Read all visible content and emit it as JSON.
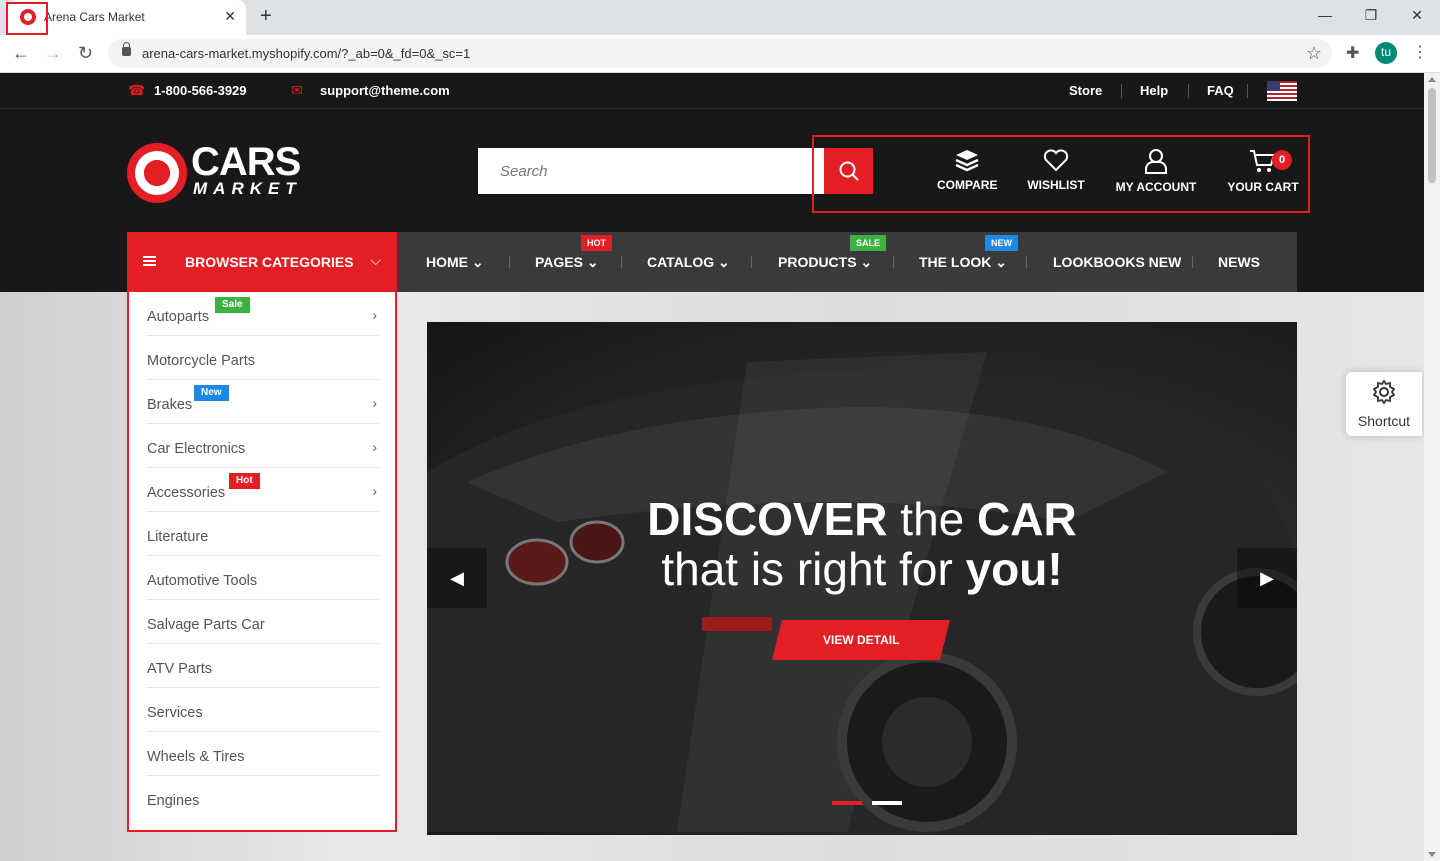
{
  "browser": {
    "tab_title": "Arena Cars Market",
    "url": "arena-cars-market.myshopify.com/?_ab=0&_fd=0&_sc=1",
    "profile_initial": "tu"
  },
  "topbar": {
    "phone": "1-800-566-3929",
    "email": "support@theme.com",
    "links": [
      "Store",
      "Help",
      "FAQ"
    ]
  },
  "logo": {
    "line1": "CARS",
    "line2": "MARKET"
  },
  "search": {
    "placeholder": "Search"
  },
  "header_actions": {
    "compare": "COMPARE",
    "wishlist": "WISHLIST",
    "account": "MY ACCOUNT",
    "cart": "YOUR CART",
    "cart_count": "0"
  },
  "category_bar": {
    "label": "BROWSER CATEGORIES"
  },
  "nav": {
    "items": [
      "HOME",
      "PAGES",
      "CATALOG",
      "PRODUCTS",
      "THE LOOK",
      "LOOKBOOKS NEW",
      "NEWS"
    ],
    "badges": {
      "pages": "HOT",
      "products": "SALE",
      "the_look": "NEW"
    }
  },
  "categories": [
    {
      "label": "Autoparts",
      "badge": "Sale",
      "badge_color": "#3cb043",
      "has_children": true
    },
    {
      "label": "Motorcycle Parts",
      "badge": "",
      "has_children": false
    },
    {
      "label": "Brakes",
      "badge": "New",
      "badge_color": "#1e88e5",
      "has_children": true
    },
    {
      "label": "Car Electronics",
      "badge": "",
      "has_children": true
    },
    {
      "label": "Accessories",
      "badge": "Hot",
      "badge_color": "#e31e24",
      "has_children": true
    },
    {
      "label": "Literature",
      "badge": "",
      "has_children": false
    },
    {
      "label": "Automotive Tools",
      "badge": "",
      "has_children": false
    },
    {
      "label": "Salvage Parts Car",
      "badge": "",
      "has_children": false
    },
    {
      "label": "ATV Parts",
      "badge": "",
      "has_children": false
    },
    {
      "label": "Services",
      "badge": "",
      "has_children": false
    },
    {
      "label": "Wheels & Tires",
      "badge": "",
      "has_children": false
    },
    {
      "label": "Engines",
      "badge": "",
      "has_children": false
    }
  ],
  "slider": {
    "line1_bold1": "DISCOVER",
    "line1_normal": " the ",
    "line1_bold2": "CAR",
    "line2_normal": "that is right for ",
    "line2_bold": "you!",
    "button": "VIEW DETAIL",
    "active_slide": 1,
    "slide_count": 2
  },
  "shortcut": {
    "label": "Shortcut"
  },
  "colors": {
    "accent": "#e31e24",
    "dark": "#181818",
    "nav": "#3a3a3a"
  }
}
